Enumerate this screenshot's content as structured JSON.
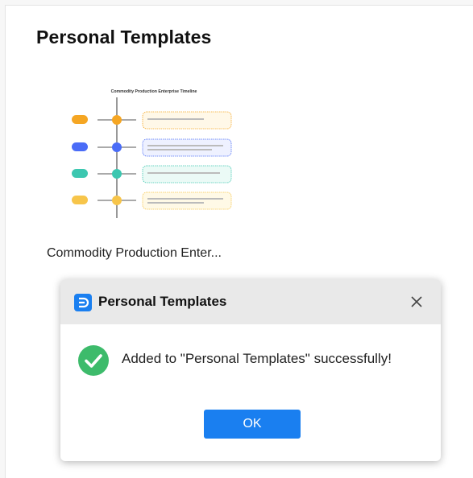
{
  "panel": {
    "title": "Personal Templates"
  },
  "template": {
    "name": "Commodity Production Enter...",
    "thumbnail_title": "Commodity Production Enterprise Timeline",
    "thumbnail_colors": [
      "#f5a623",
      "#4a6cf7",
      "#3cc7b0",
      "#f7c54a"
    ]
  },
  "dialog": {
    "title": "Personal Templates",
    "message": "Added to \"Personal Templates\" successfully!",
    "ok_label": "OK",
    "logo_icon": "edraw-logo-icon",
    "close_icon": "close-icon",
    "status_icon": "success-check-icon",
    "accent_color": "#1a7ff0",
    "success_color": "#3dbb6b"
  }
}
